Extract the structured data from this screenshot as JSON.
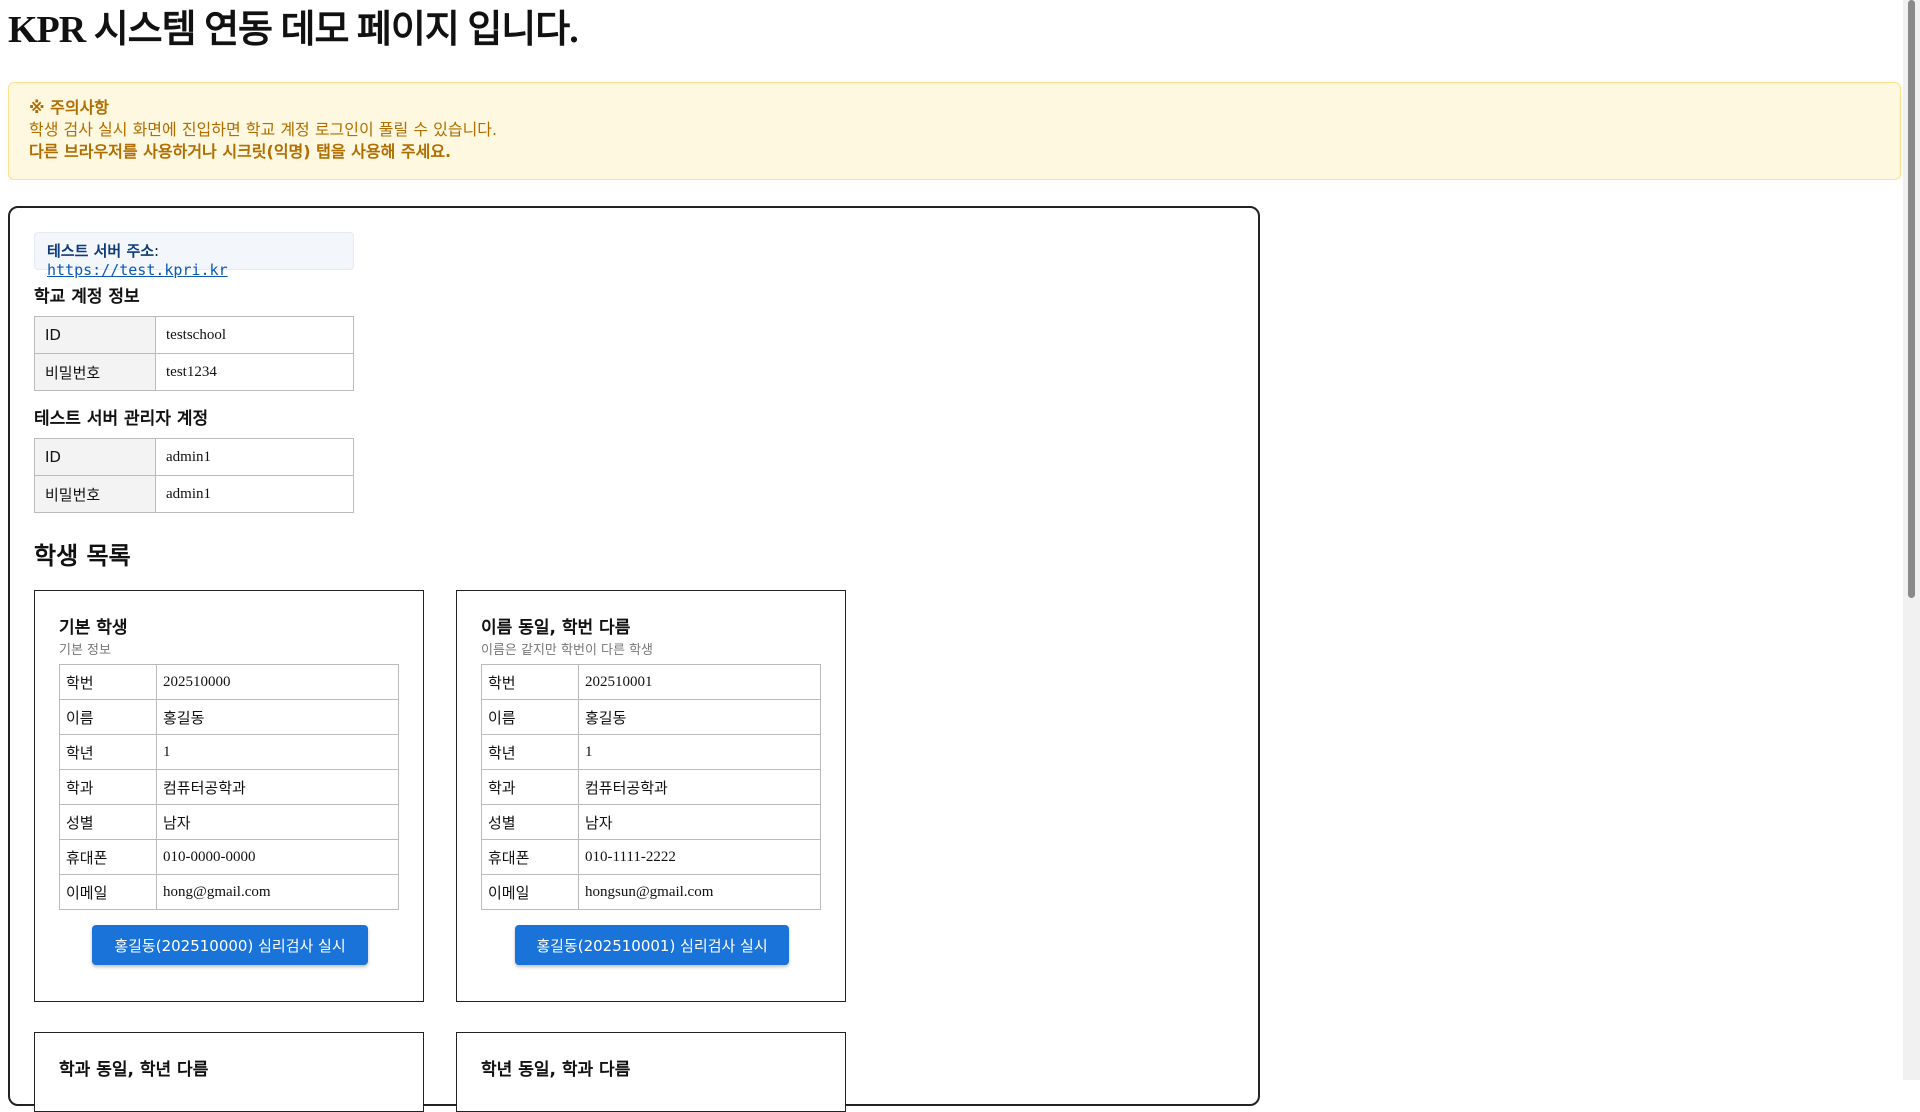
{
  "header": {
    "title": "KPR 시스템 연동 데모 페이지 입니다."
  },
  "notice": {
    "title": "※ 주의사항",
    "line1": "학생 검사 실시 화면에 진입하면 학교 계정 로그인이 풀릴 수 있습니다.",
    "line2": "다른 브라우저를 사용하거나 시크릿(익명) 탭을 사용해 주세요."
  },
  "server": {
    "label": "테스트 서버 주소",
    "sep": ":",
    "url": "https://test.kpri.kr"
  },
  "school_account": {
    "title": "학교 계정 정보",
    "rows": [
      {
        "k": "ID",
        "v": "testschool"
      },
      {
        "k": "비밀번호",
        "v": "test1234"
      }
    ]
  },
  "admin_account": {
    "title": "테스트 서버 관리자 계정",
    "rows": [
      {
        "k": "ID",
        "v": "admin1"
      },
      {
        "k": "비밀번호",
        "v": "admin1"
      }
    ]
  },
  "students": {
    "title": "학생 목록",
    "fields": [
      "학번",
      "이름",
      "학년",
      "학과",
      "성별",
      "휴대폰",
      "이메일"
    ],
    "cards": [
      {
        "title": "기본 학생",
        "subtitle": "기본 정보",
        "values": [
          "202510000",
          "홍길동",
          "1",
          "컴퓨터공학과",
          "남자",
          "010-0000-0000",
          "hong@gmail.com"
        ],
        "button": "홍길동(202510000) 심리검사 실시"
      },
      {
        "title": "이름 동일, 학번 다름",
        "subtitle": "이름은 같지만 학번이 다른 학생",
        "values": [
          "202510001",
          "홍길동",
          "1",
          "컴퓨터공학과",
          "남자",
          "010-1111-2222",
          "hongsun@gmail.com"
        ],
        "button": "홍길동(202510001) 심리검사 실시"
      },
      {
        "title": "학과 동일, 학년 다름"
      },
      {
        "title": "학년 동일, 학과 다름"
      }
    ]
  }
}
